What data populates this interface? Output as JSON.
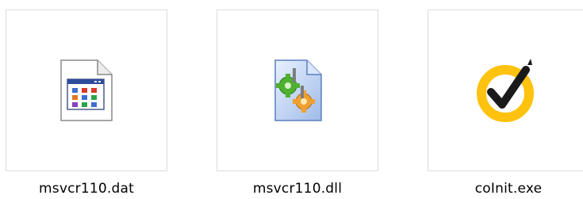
{
  "files": [
    {
      "name": "msvcr110.dat",
      "icon": "generic-application-file-icon"
    },
    {
      "name": "msvcr110.dll",
      "icon": "dll-gears-file-icon"
    },
    {
      "name": "coInit.exe",
      "icon": "norton-checkmark-icon"
    }
  ],
  "colors": {
    "thumbnail_border": "#dcdcdc",
    "norton_yellow": "#ffc20e",
    "norton_check": "#1a1a1a"
  }
}
